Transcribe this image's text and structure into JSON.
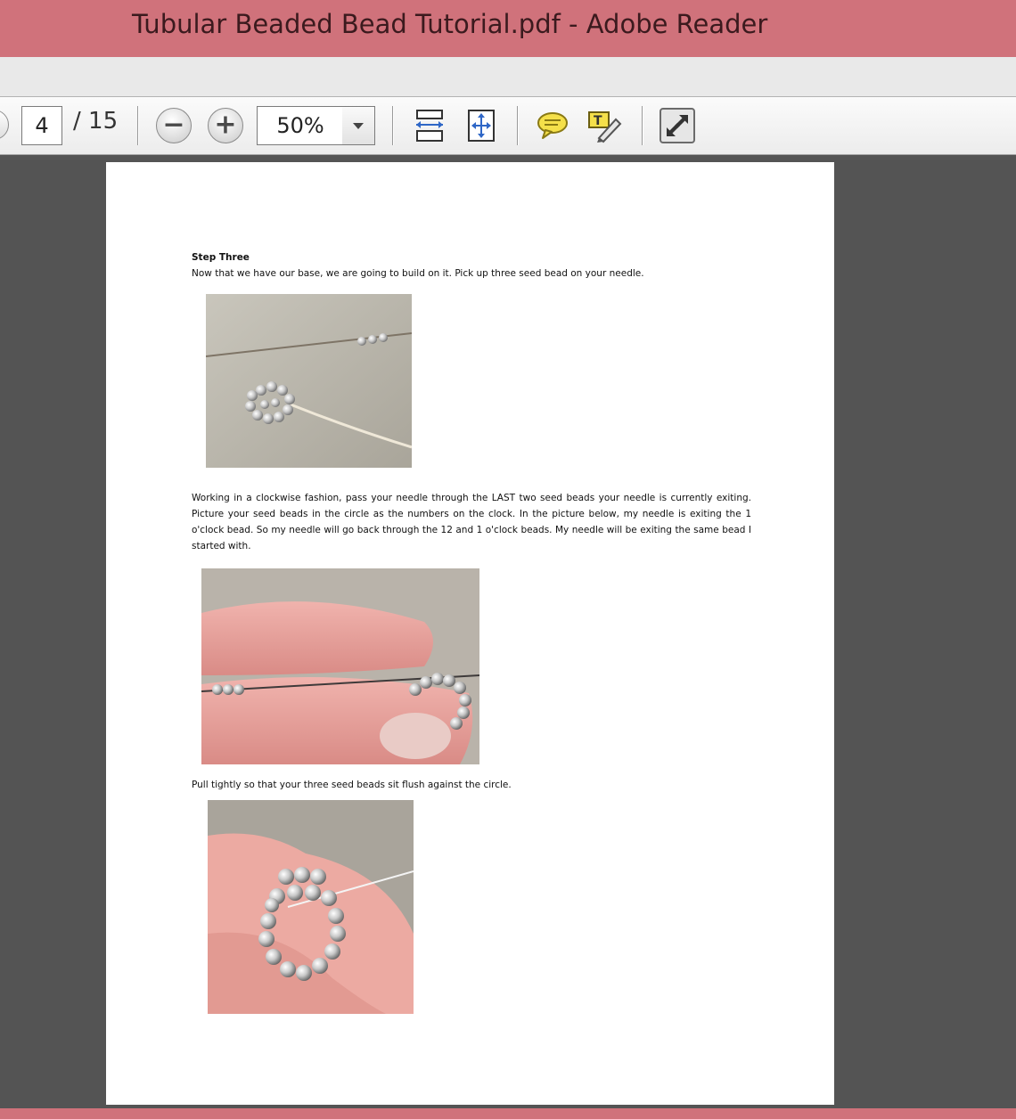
{
  "window": {
    "title": "Tubular Beaded Bead Tutorial.pdf - Adobe Reader"
  },
  "toolbar": {
    "current_page": "4",
    "page_total": "/  15",
    "zoom": "50%"
  },
  "icons": [
    "previous-page-icon",
    "zoom-out-icon",
    "zoom-in-icon",
    "fit-width-icon",
    "fit-page-icon",
    "comment-icon",
    "highlight-text-icon",
    "full-screen-icon"
  ],
  "document": {
    "step_heading": "Step Three",
    "step_text": "Now that we have our base, we are going to build on it. Pick up three seed bead on your needle.",
    "paragraph2": "Working in a clockwise fashion, pass your needle through the LAST two seed beads your needle is currently exiting. Picture your seed beads in the circle as the numbers on the clock. In the picture below, my needle is exiting the 1 o'clock bead. So my needle will go back through the 12 and 1 o'clock beads. My needle will be exiting the same bead I started with.",
    "paragraph3": "Pull tightly so that your three seed beads sit flush against the circle."
  },
  "colors": {
    "titlebar": "#d0727b",
    "workspace": "#545454",
    "page": "#ffffff"
  }
}
